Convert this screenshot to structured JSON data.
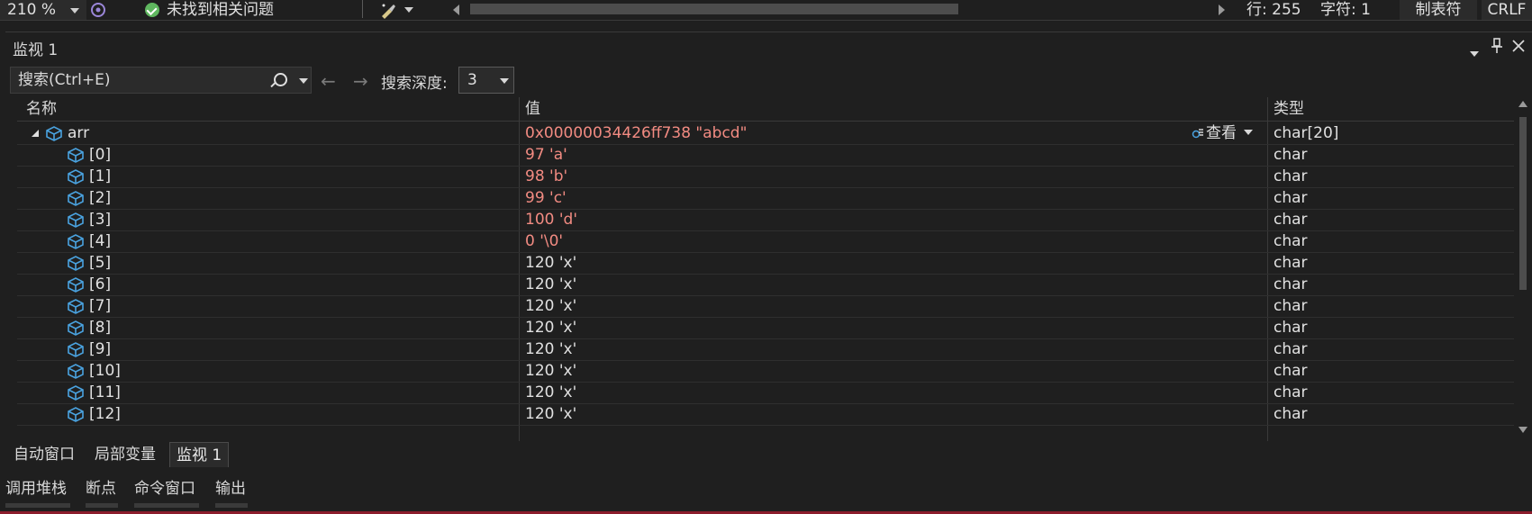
{
  "status_bar": {
    "zoom": "210 %",
    "issues_text": "未找到相关问题",
    "line": "行: 255",
    "char": "字符: 1",
    "tab_mode": "制表符",
    "line_ending": "CRLF"
  },
  "watch_panel": {
    "title": "监视 1",
    "search_placeholder": "搜索(Ctrl+E)",
    "depth_label": "搜索深度:",
    "depth_value": "3",
    "columns": {
      "name": "名称",
      "value": "值",
      "type": "类型"
    },
    "view_label": "查看",
    "rows": [
      {
        "name": "arr",
        "value": "0x00000034426ff738 \"abcd\"",
        "type": "char[20]",
        "level": 0,
        "changed": true
      },
      {
        "name": "[0]",
        "value": "97 'a'",
        "type": "char",
        "level": 1,
        "changed": true
      },
      {
        "name": "[1]",
        "value": "98 'b'",
        "type": "char",
        "level": 1,
        "changed": true
      },
      {
        "name": "[2]",
        "value": "99 'c'",
        "type": "char",
        "level": 1,
        "changed": true
      },
      {
        "name": "[3]",
        "value": "100 'd'",
        "type": "char",
        "level": 1,
        "changed": true
      },
      {
        "name": "[4]",
        "value": "0 '\\0'",
        "type": "char",
        "level": 1,
        "changed": true
      },
      {
        "name": "[5]",
        "value": "120 'x'",
        "type": "char",
        "level": 1,
        "changed": false
      },
      {
        "name": "[6]",
        "value": "120 'x'",
        "type": "char",
        "level": 1,
        "changed": false
      },
      {
        "name": "[7]",
        "value": "120 'x'",
        "type": "char",
        "level": 1,
        "changed": false
      },
      {
        "name": "[8]",
        "value": "120 'x'",
        "type": "char",
        "level": 1,
        "changed": false
      },
      {
        "name": "[9]",
        "value": "120 'x'",
        "type": "char",
        "level": 1,
        "changed": false
      },
      {
        "name": "[10]",
        "value": "120 'x'",
        "type": "char",
        "level": 1,
        "changed": false
      },
      {
        "name": "[11]",
        "value": "120 'x'",
        "type": "char",
        "level": 1,
        "changed": false
      },
      {
        "name": "[12]",
        "value": "120 'x'",
        "type": "char",
        "level": 1,
        "changed": false
      }
    ]
  },
  "debug_tabs": [
    {
      "label": "自动窗口",
      "active": false
    },
    {
      "label": "局部变量",
      "active": false
    },
    {
      "label": "监视 1",
      "active": true
    }
  ],
  "tool_tabs": [
    {
      "label": "调用堆栈"
    },
    {
      "label": "断点"
    },
    {
      "label": "命令窗口"
    },
    {
      "label": "输出"
    }
  ],
  "colors": {
    "changed_value": "#f28b82",
    "normal_value": "#e0e0e0",
    "variable_icon": "#4aa3e0",
    "accent_bar": "#8b1c2c"
  },
  "icons": {
    "status_ok": "check-circle-icon",
    "variable": "variable-cube-icon",
    "search": "search-icon",
    "nav_back": "arrow-left-icon",
    "nav_forward": "arrow-right-icon",
    "pin": "pin-icon",
    "close": "close-icon"
  }
}
